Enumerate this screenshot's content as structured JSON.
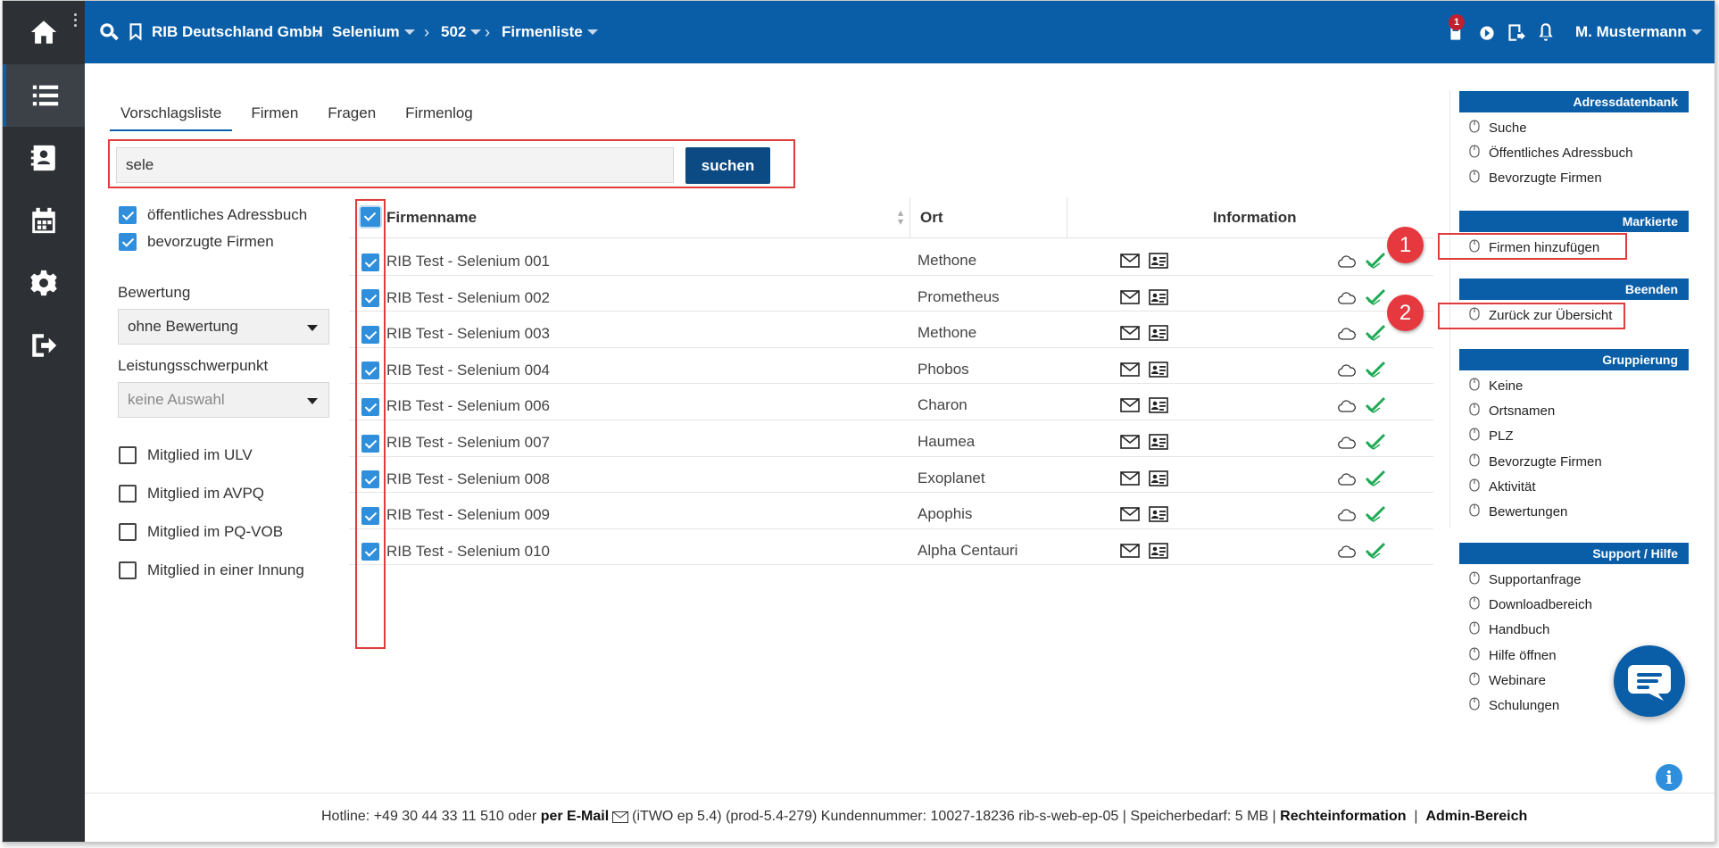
{
  "header": {
    "breadcrumb": [
      {
        "label": "RIB Deutschland GmbH",
        "dropdown": false
      },
      {
        "label": "Selenium",
        "dropdown": true
      },
      {
        "label": "502",
        "dropdown": true
      },
      {
        "label": "Firmenliste",
        "dropdown": true
      }
    ],
    "notification_count": "1",
    "user": "M. Mustermann"
  },
  "tabs": [
    "Vorschlagsliste",
    "Firmen",
    "Fragen",
    "Firmenlog"
  ],
  "search": {
    "value": "sele",
    "button": "suchen"
  },
  "filters": {
    "sources": [
      {
        "label": "öffentliches Adressbuch",
        "checked": true
      },
      {
        "label": "bevorzugte Firmen",
        "checked": true
      }
    ],
    "bewertung_label": "Bewertung",
    "bewertung_value": "ohne Bewertung",
    "leistung_label": "Leistungsschwerpunkt",
    "leistung_value": "keine Auswahl",
    "memberships": [
      {
        "label": "Mitglied im ULV",
        "checked": false
      },
      {
        "label": "Mitglied im AVPQ",
        "checked": false
      },
      {
        "label": "Mitglied im PQ-VOB",
        "checked": false
      },
      {
        "label": "Mitglied in einer Innung",
        "checked": false
      }
    ]
  },
  "table": {
    "columns": {
      "firmenname": "Firmenname",
      "ort": "Ort",
      "information": "Information"
    },
    "rows": [
      {
        "name": "RIB Test - Selenium 001",
        "ort": "Methone",
        "checked": true
      },
      {
        "name": "RIB Test - Selenium 002",
        "ort": "Prometheus",
        "checked": true
      },
      {
        "name": "RIB Test - Selenium 003",
        "ort": "Methone",
        "checked": true
      },
      {
        "name": "RIB Test - Selenium 004",
        "ort": "Phobos",
        "checked": true
      },
      {
        "name": "RIB Test - Selenium 006",
        "ort": "Charon",
        "checked": true
      },
      {
        "name": "RIB Test - Selenium 007",
        "ort": "Haumea",
        "checked": true
      },
      {
        "name": "RIB Test - Selenium 008",
        "ort": "Exoplanet",
        "checked": true
      },
      {
        "name": "RIB Test - Selenium 009",
        "ort": "Apophis",
        "checked": true
      },
      {
        "name": "RIB Test - Selenium 010",
        "ort": "Alpha Centauri",
        "checked": true
      }
    ]
  },
  "sidebar": {
    "adressdatenbank": {
      "title": "Adressdatenbank",
      "items": [
        "Suche",
        "Öffentliches Adressbuch",
        "Bevorzugte Firmen"
      ]
    },
    "markierte": {
      "title": "Markierte",
      "items": [
        "Firmen hinzufügen"
      ]
    },
    "beenden": {
      "title": "Beenden",
      "items": [
        "Zurück zur Übersicht"
      ]
    },
    "gruppierung": {
      "title": "Gruppierung",
      "items": [
        "Keine",
        "Ortsnamen",
        "PLZ",
        "Bevorzugte Firmen",
        "Aktivität",
        "Bewertungen"
      ]
    },
    "support": {
      "title": "Support / Hilfe",
      "items": [
        "Supportanfrage",
        "Downloadbereich",
        "Handbuch",
        "Hilfe öffnen",
        "Webinare",
        "Schulungen"
      ]
    }
  },
  "markers": [
    "1",
    "2"
  ],
  "footer": {
    "hotline": "Hotline: +49 30 44 33 11 510 oder",
    "email_link": "per E-Mail",
    "info": "(iTWO ep 5.4) (prod-5.4-279)   Kundennummer: 10027-18236 rib-s-web-ep-05 | Speicherbedarf: 5 MB |",
    "rechte": "Rechteinformation",
    "sep": "|",
    "admin": "Admin-Bereich"
  },
  "colors": {
    "primary": "#0a5ea8",
    "rail": "#2d3135",
    "check": "#2f8fdc",
    "highlight": "#e03c3c",
    "ok_green": "#1faa55"
  }
}
